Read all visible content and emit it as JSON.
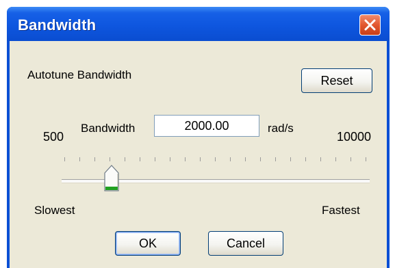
{
  "window": {
    "title": "Bandwidth"
  },
  "content": {
    "heading": "Autotune Bandwidth",
    "reset_label": "Reset",
    "bandwidth_label": "Bandwidth",
    "bandwidth_value": "2000.00",
    "unit_label": "rad/s",
    "min_label": "500",
    "max_label": "10000",
    "slider": {
      "min": 500,
      "max": 10000,
      "value": 2000,
      "tick_count": 21
    },
    "slow_label": "Slowest",
    "fast_label": "Fastest",
    "ok_label": "OK",
    "cancel_label": "Cancel"
  },
  "colors": {
    "titlebar": "#0b4fd4",
    "close_button": "#e2582f",
    "client_bg": "#ece9d8",
    "thumb_accent": "#21a121"
  },
  "icons": {
    "close": "close-icon"
  }
}
